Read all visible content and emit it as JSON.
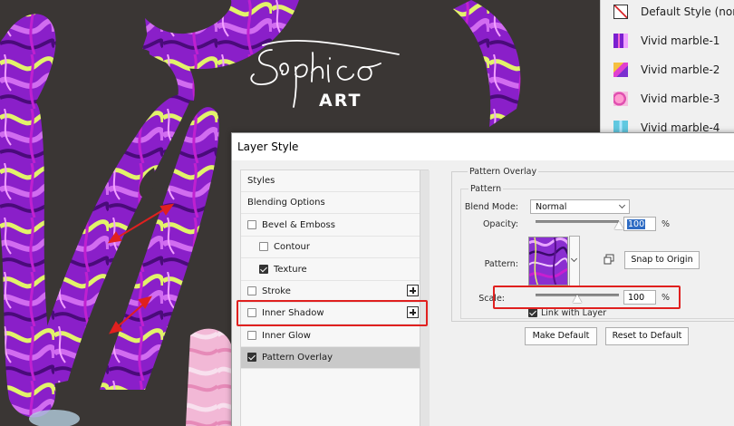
{
  "artwork": {
    "logo_text": "ART"
  },
  "styles_panel": {
    "items": [
      {
        "label": "Default Style (none)",
        "icon": "no-style-icon"
      },
      {
        "label": "Vivid marble-1",
        "icon": "marble-swatch-1"
      },
      {
        "label": "Vivid marble-2",
        "icon": "marble-swatch-2"
      },
      {
        "label": "Vivid marble-3",
        "icon": "marble-swatch-3"
      },
      {
        "label": "Vivid marble-4",
        "icon": "marble-swatch-4"
      }
    ]
  },
  "dialog": {
    "title": "Layer Style",
    "style_list": [
      {
        "label": "Styles",
        "checkbox": false,
        "checked": false,
        "plus": false,
        "selected": false
      },
      {
        "label": "Blending Options",
        "checkbox": false,
        "checked": false,
        "plus": false,
        "selected": false
      },
      {
        "label": "Bevel & Emboss",
        "checkbox": true,
        "checked": false,
        "plus": false,
        "selected": false
      },
      {
        "label": "Contour",
        "checkbox": true,
        "checked": false,
        "plus": false,
        "selected": false,
        "indent": true
      },
      {
        "label": "Texture",
        "checkbox": true,
        "checked": true,
        "plus": false,
        "selected": false,
        "indent": true
      },
      {
        "label": "Stroke",
        "checkbox": true,
        "checked": false,
        "plus": true,
        "selected": false
      },
      {
        "label": "Inner Shadow",
        "checkbox": true,
        "checked": false,
        "plus": true,
        "selected": false
      },
      {
        "label": "Inner Glow",
        "checkbox": true,
        "checked": false,
        "plus": false,
        "selected": false
      },
      {
        "label": "Pattern Overlay",
        "checkbox": true,
        "checked": true,
        "plus": false,
        "selected": true
      }
    ],
    "pattern_overlay": {
      "group_title": "Pattern Overlay",
      "subgroup_title": "Pattern",
      "blend_mode_label": "Blend Mode:",
      "blend_mode_value": "Normal",
      "opacity_label": "Opacity:",
      "opacity_value": "100",
      "opacity_unit": "%",
      "opacity_level": 1.0,
      "pattern_label": "Pattern:",
      "snap_to_origin": "Snap to Origin",
      "scale_label": "Scale:",
      "scale_value": "100",
      "scale_unit": "%",
      "scale_level": 0.5,
      "link_with_layer_label": "Link with Layer",
      "link_with_layer_checked": true,
      "make_default": "Make Default",
      "reset_to_default": "Reset to Default"
    }
  },
  "colors": {
    "highlight": "#e0201f",
    "arrow": "#e0201f",
    "selection": "#2e6cc4",
    "marble_purple": "#9b2bd6",
    "marble_yellow": "#e6f06a"
  }
}
